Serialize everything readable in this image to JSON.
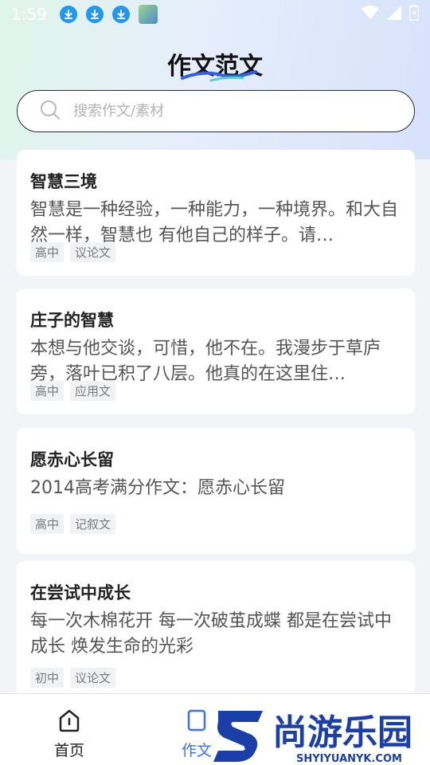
{
  "status_bar": {
    "time": "1:59",
    "icons": [
      "download-icon",
      "download-icon",
      "download-icon",
      "app-thumbnail",
      "wifi-icon",
      "signal-icon",
      "battery-icon"
    ]
  },
  "header": {
    "title": "作文范文",
    "underline_color": "#2f5fe8"
  },
  "search": {
    "placeholder": "搜索作文/素材",
    "value": ""
  },
  "articles": [
    {
      "title": "智慧三境",
      "excerpt": "智慧是一种经验，一种能力，一种境界。和大自然一样，智慧也 有他自己的样子。请…",
      "tags": [
        "高中",
        "议论文"
      ]
    },
    {
      "title": "庄子的智慧",
      "excerpt": "本想与他交谈，可惜，他不在。我漫步于草庐旁，落叶已积了八层。他真的在这里住…",
      "tags": [
        "高中",
        "应用文"
      ]
    },
    {
      "title": "愿赤心长留",
      "excerpt": "2014高考满分作文：愿赤心长留",
      "tags": [
        "高中",
        "记叙文"
      ]
    },
    {
      "title": "在尝试中成长",
      "excerpt": "每一次木棉花开￼ 每一次破茧成蝶￼ 都是在尝试中成长￼ 焕发生命的光彩￼",
      "tags": [
        "初中",
        "议论文"
      ]
    }
  ],
  "bottom_nav": {
    "items": [
      {
        "label": "首页",
        "icon": "home-icon",
        "active": false
      },
      {
        "label": "作文",
        "icon": "essay-icon",
        "active": true
      }
    ],
    "active_color": "#3b6ff5"
  },
  "watermark": {
    "brand": "尚游乐园",
    "domain": "SHYIYUANYK.COM",
    "color": "#1a3fa8"
  }
}
